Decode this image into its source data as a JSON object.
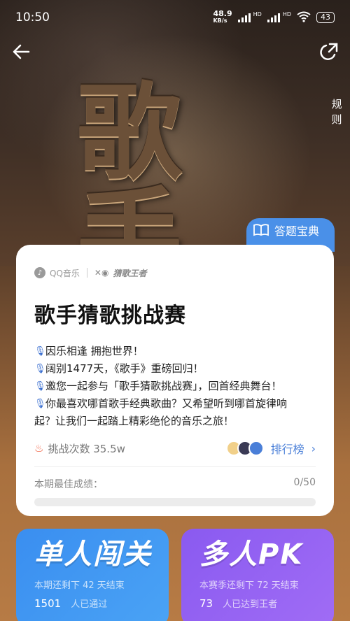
{
  "status_bar": {
    "time": "10:50",
    "net_speed": "48.9",
    "net_unit": "KB/s",
    "hd1": "HD",
    "hd2": "HD",
    "battery": "43"
  },
  "nav": {
    "back_icon": "arrow-left-icon",
    "share_icon": "share-icon",
    "rules_label": "规则"
  },
  "hero": {
    "title_art": "歌手"
  },
  "guide_tab": {
    "label": "答题宝典",
    "icon": "book-icon"
  },
  "card": {
    "brand_qq": "QQ音乐",
    "brand_game": "猜歌王者",
    "title": "歌手猜歌挑战赛",
    "description_lines": [
      "因乐相逢 拥抱世界！",
      "阔别1477天，《歌手》重磅回归！",
      "邀您一起参与「歌手猜歌挑战赛」，回首经典舞台！",
      "你最喜欢哪首歌手经典歌曲？又希望听到哪首旋律响",
      "起？让我们一起踏上精彩绝伦的音乐之旅！"
    ],
    "challenge_count": "挑战次数 35.5w",
    "ranking_label": "排行榜",
    "best_score_label": "本期最佳成绩：",
    "best_score_value": "0/50",
    "progress_fraction": 0
  },
  "modes": {
    "solo": {
      "title": "单人闯关",
      "subtitle": "本期还剩下 42 天结束",
      "count": "1501",
      "count_label": "人已通过"
    },
    "pk": {
      "title": "多人PK",
      "subtitle": "本赛季还剩下 72 天结束",
      "count": "73",
      "count_label": "人已达到王者"
    }
  },
  "colors": {
    "accent_blue": "#4a90e8",
    "solo_card": "#3a8ef0",
    "pk_card": "#8a5af0",
    "link_blue": "#4a7fd8"
  }
}
